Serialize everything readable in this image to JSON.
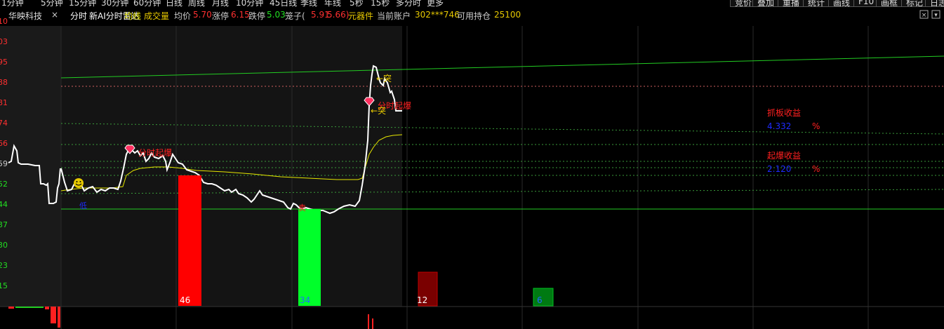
{
  "topbar": {
    "periods": [
      "1分钟",
      "5分钟",
      "15分钟",
      "30分钟",
      "60分钟",
      "日线",
      "周线",
      "月线",
      "10分钟",
      "45日线",
      "季线",
      "年线",
      "5秒",
      "15秒",
      "多分时",
      "更多"
    ],
    "right_buttons": [
      "竞价",
      "叠加",
      "重播",
      "统计",
      "画线",
      "F10",
      "画框",
      "标记",
      "日志"
    ]
  },
  "header": {
    "stock_name": "华映科技",
    "close_mark": "×",
    "mode": "分时",
    "indicator": "新AI分时雷达",
    "avg_line_label": "均线",
    "volume_label": "成交量",
    "avg_price_label": "均价",
    "avg_price": "5.70",
    "limit_up_label": "涨停",
    "limit_up": "6.15",
    "limit_down_label": "跌停",
    "limit_down": "5.03",
    "cage_label": "笼子(",
    "cage_low": "5.91",
    "cage_high": "5.66)",
    "component_label": "元器件",
    "account_label": "当前账户",
    "account_id": "302***746",
    "available_label": "可用持仓",
    "available": "25100"
  },
  "axis": {
    "left_labels": [
      "10",
      "03",
      "95",
      "88",
      "81",
      "74",
      "66",
      "59",
      "52",
      "44",
      "37",
      "30",
      "23",
      "15"
    ]
  },
  "annotations": {
    "grab_board_label": "抓板收益",
    "grab_board_value": "4.332",
    "grab_board_unit": "%",
    "explode_label": "起爆收益",
    "explode_value": "2.120",
    "explode_unit": "%",
    "explode_tag_1": "分时起爆",
    "explode_tag_2": "分时起爆",
    "break_tag_1": "←突",
    "break_tag_2": "←突",
    "low_tag": "低",
    "sell_tag": "卖"
  },
  "volume_bars": [
    {
      "label": "46",
      "color": "#ff0000"
    },
    {
      "label": "34",
      "color": "#00ff2a"
    },
    {
      "label": "12",
      "color": "#7a0000"
    },
    {
      "label": "6",
      "color": "#007a12"
    }
  ],
  "colors": {
    "price_line": "#ffffff",
    "avg_line": "#e6e600",
    "up": "#ff0000",
    "down": "#00ff00",
    "label_red": "#ff2020",
    "label_blue": "#1e2bff",
    "gold": "#e6c800"
  }
}
